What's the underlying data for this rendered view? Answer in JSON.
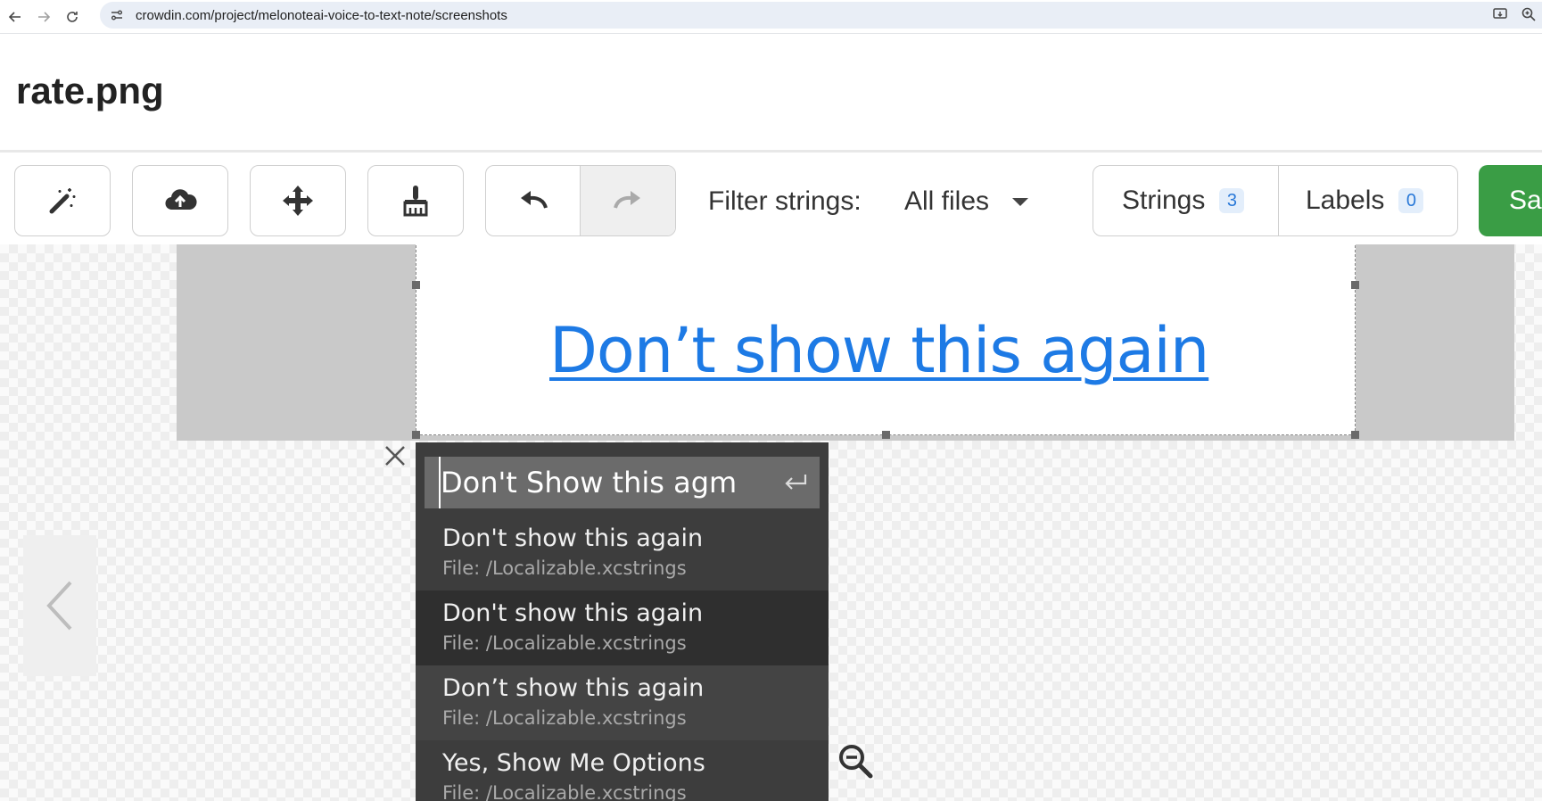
{
  "browser": {
    "url": "crowdin.com/project/melonoteai-voice-to-text-note/screenshots"
  },
  "page": {
    "title": "rate.png"
  },
  "toolbar": {
    "filter_label": "Filter strings:",
    "filter_value": "All files",
    "strings_tab": "Strings",
    "strings_count": "3",
    "labels_tab": "Labels",
    "labels_count": "0",
    "save_label": "Sav"
  },
  "screenshot": {
    "tagged_text": "Don’t show this again"
  },
  "suggest": {
    "input_value": "Don't Show this agm",
    "items": [
      {
        "text": "Don't show this again",
        "file": "File: /Localizable.xcstrings"
      },
      {
        "text": "Don't show this again",
        "file": "File: /Localizable.xcstrings"
      },
      {
        "text": "Don’t show this again",
        "file": "File: /Localizable.xcstrings"
      },
      {
        "text": "Yes, Show Me Options",
        "file": "File: /Localizable.xcstrings"
      }
    ]
  },
  "colors": {
    "accent_link": "#1d7ae5",
    "save_green": "#3a9d45",
    "badge_blue": "#2a79d8",
    "panel_dark": "#3d3d3d"
  },
  "icons": [
    "back-icon",
    "forward-icon",
    "reload-icon",
    "site-settings-icon",
    "install-icon",
    "zoom-icon",
    "magic-wand-icon",
    "cloud-upload-icon",
    "move-icon",
    "broom-icon",
    "undo-icon",
    "redo-icon",
    "caret-down-icon",
    "close-icon",
    "chevron-left-icon",
    "zoom-out-icon",
    "enter-icon"
  ]
}
